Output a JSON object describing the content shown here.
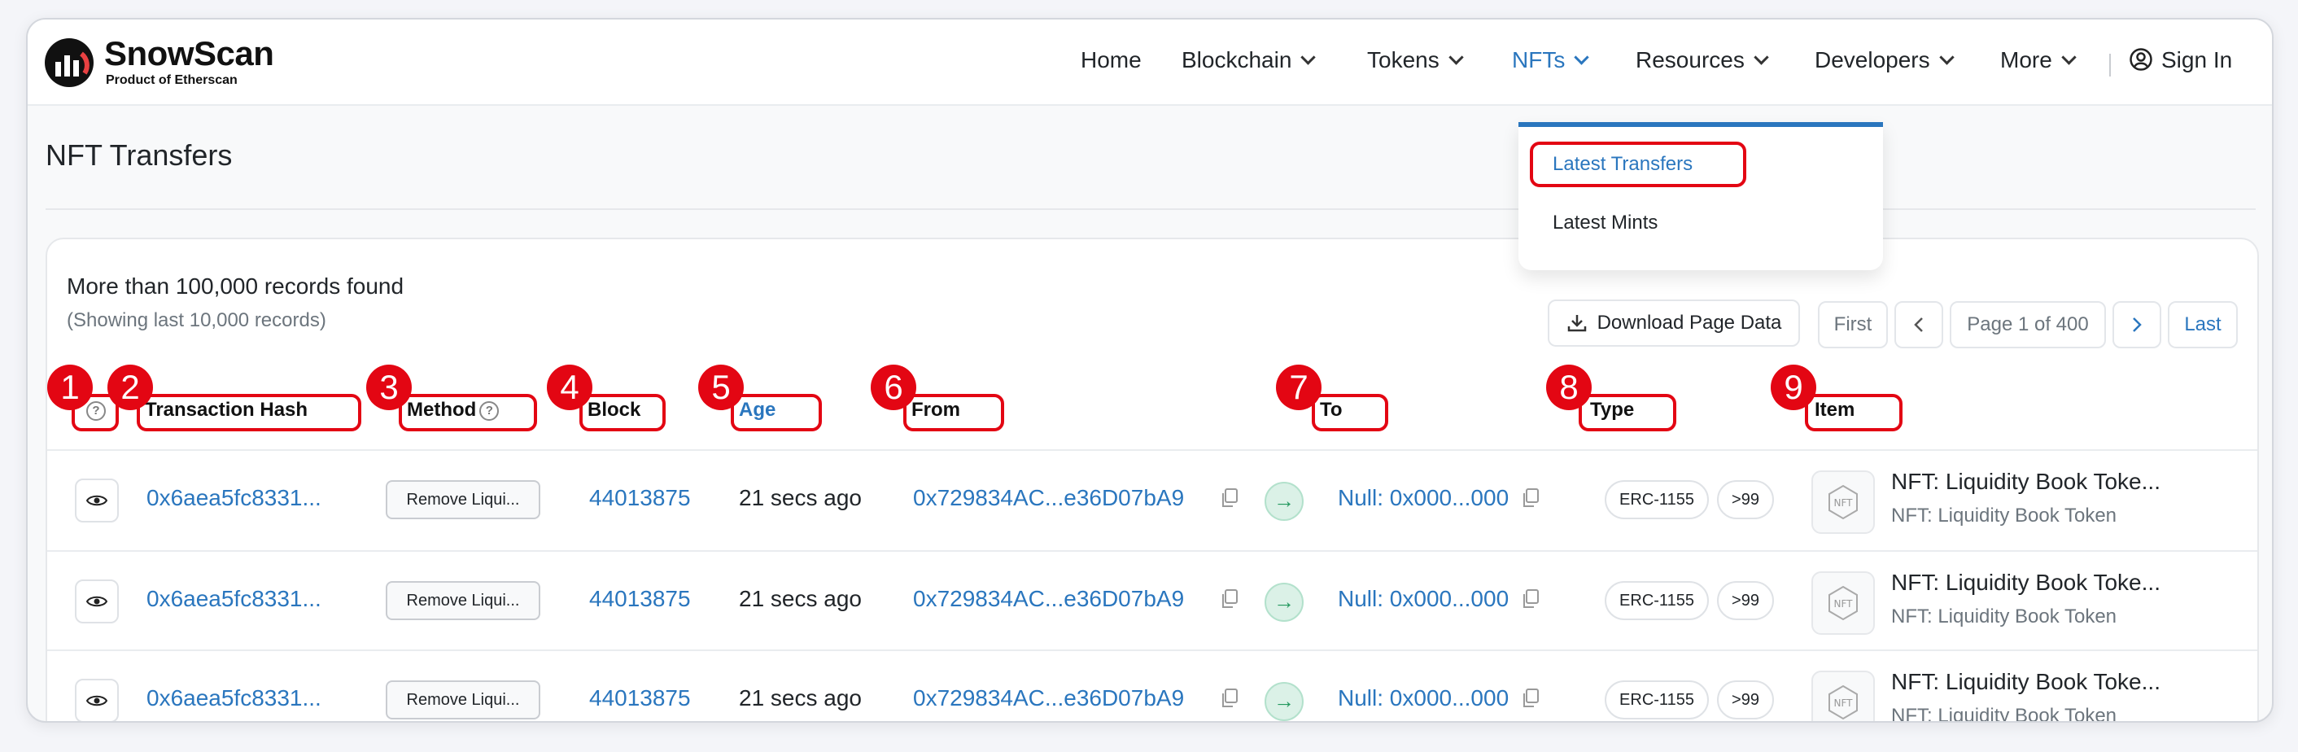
{
  "header": {
    "brand": "SnowScan",
    "tagline": "Product of Etherscan",
    "nav": [
      "Home",
      "Blockchain",
      "Tokens",
      "NFTs",
      "Resources",
      "Developers",
      "More"
    ],
    "sign_in": "Sign In"
  },
  "dropdown": {
    "items": [
      "Latest Transfers",
      "Latest Mints"
    ]
  },
  "page": {
    "title": "NFT Transfers",
    "records_found": "More than 100,000 records found",
    "records_note": "(Showing last 10,000 records)",
    "download": "Download Page Data",
    "pager": {
      "first": "First",
      "page": "Page 1 of 400",
      "last": "Last"
    }
  },
  "columns": {
    "hash": "Transaction Hash",
    "method": "Method",
    "block": "Block",
    "age": "Age",
    "from": "From",
    "to": "To",
    "type": "Type",
    "item": "Item"
  },
  "badges": [
    "1",
    "2",
    "3",
    "4",
    "5",
    "6",
    "7",
    "8",
    "9"
  ],
  "rows": [
    {
      "hash": "0x6aea5fc8331...",
      "method": "Remove Liqui...",
      "block": "44013875",
      "age": "21 secs ago",
      "from": "0x729834AC...e36D07bA9",
      "to": "Null: 0x000...000",
      "type": "ERC-1155",
      "qty": ">99",
      "item_title": "NFT: Liquidity Book Toke...",
      "item_sub": "NFT: Liquidity Book Token"
    },
    {
      "hash": "0x6aea5fc8331...",
      "method": "Remove Liqui...",
      "block": "44013875",
      "age": "21 secs ago",
      "from": "0x729834AC...e36D07bA9",
      "to": "Null: 0x000...000",
      "type": "ERC-1155",
      "qty": ">99",
      "item_title": "NFT: Liquidity Book Toke...",
      "item_sub": "NFT: Liquidity Book Token"
    },
    {
      "hash": "0x6aea5fc8331...",
      "method": "Remove Liqui...",
      "block": "44013875",
      "age": "21 secs ago",
      "from": "0x729834AC...e36D07bA9",
      "to": "Null: 0x000...000",
      "type": "ERC-1155",
      "qty": ">99",
      "item_title": "NFT: Liquidity Book Toke...",
      "item_sub": "NFT: Liquidity Book Token"
    }
  ],
  "colors": {
    "link": "#2a76be",
    "annotation": "#e30613",
    "success": "#24995f"
  }
}
